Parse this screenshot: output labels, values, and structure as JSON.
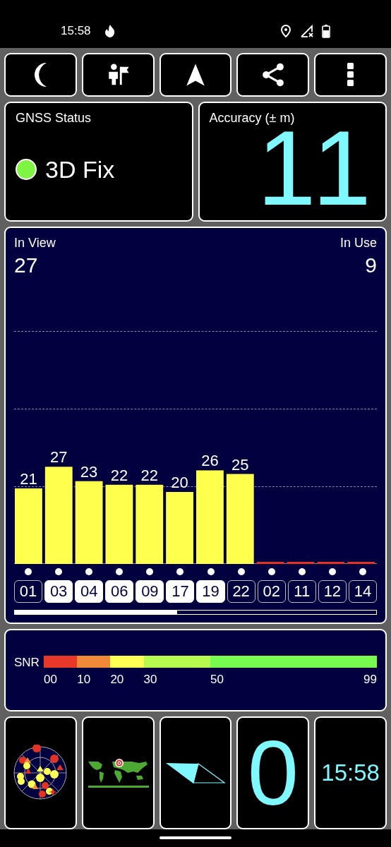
{
  "status_bar": {
    "time": "15:58"
  },
  "toolbar": [
    {
      "kind": "moon"
    },
    {
      "kind": "person-flag"
    },
    {
      "kind": "navigation"
    },
    {
      "kind": "share"
    },
    {
      "kind": "more"
    }
  ],
  "gnss_status": {
    "title": "GNSS Status",
    "value": "3D Fix",
    "color": "#7ef542"
  },
  "accuracy": {
    "title": "Accuracy (± m)",
    "value": "11"
  },
  "satellites": {
    "in_view_label": "In View",
    "in_view": "27",
    "in_use_label": "In Use",
    "in_use": "9",
    "chart_data": {
      "type": "bar",
      "categories": [
        "01",
        "03",
        "04",
        "06",
        "09",
        "17",
        "19",
        "22",
        "02",
        "11",
        "12",
        "14"
      ],
      "values": [
        21,
        27,
        23,
        22,
        22,
        20,
        26,
        25,
        0,
        0,
        0,
        0
      ],
      "value_labels": [
        "21",
        "27",
        "23",
        "22",
        "22",
        "20",
        "26",
        "25",
        null,
        null,
        null,
        null
      ]
    },
    "items": [
      {
        "color": "#ffff4d",
        "used": false
      },
      {
        "color": "#ffff4d",
        "used": true
      },
      {
        "color": "#ffff4d",
        "used": true
      },
      {
        "color": "#ffff4d",
        "used": true
      },
      {
        "color": "#ffff4d",
        "used": true
      },
      {
        "color": "#ffff4d",
        "used": true
      },
      {
        "color": "#ffff4d",
        "used": true
      },
      {
        "color": "#ffff4d",
        "used": false
      },
      {
        "color": "#e53222",
        "used": false
      },
      {
        "color": "#e53222",
        "used": false
      },
      {
        "color": "#e53222",
        "used": false
      },
      {
        "color": "#e53222",
        "used": false
      }
    ]
  },
  "snr_legend": {
    "label": "SNR",
    "segments": [
      {
        "tick": "00",
        "color": "#e8382a"
      },
      {
        "tick": "10",
        "color": "#f08a38"
      },
      {
        "tick": "20",
        "color": "#ffff55"
      },
      {
        "tick": "30",
        "color": "#b8fb50"
      },
      {
        "tick": "50",
        "color": "#78fb50"
      }
    ],
    "end_tick": "99"
  },
  "tiles": [
    {
      "kind": "skyplot"
    },
    {
      "kind": "worldmap"
    },
    {
      "kind": "arrow"
    },
    {
      "kind": "speed",
      "text": "0"
    },
    {
      "kind": "clock",
      "text": "15:58"
    }
  ]
}
